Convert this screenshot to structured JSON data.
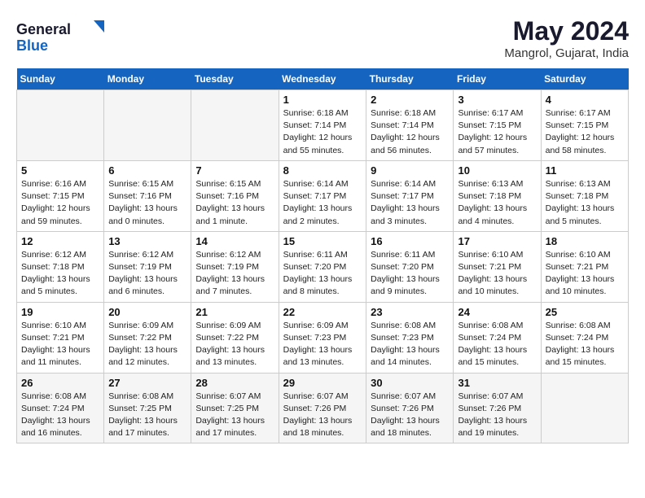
{
  "logo": {
    "general": "General",
    "blue": "Blue"
  },
  "title": {
    "month": "May 2024",
    "location": "Mangrol, Gujarat, India"
  },
  "weekdays": [
    "Sunday",
    "Monday",
    "Tuesday",
    "Wednesday",
    "Thursday",
    "Friday",
    "Saturday"
  ],
  "weeks": [
    [
      {
        "day": "",
        "sunrise": "",
        "sunset": "",
        "daylight": ""
      },
      {
        "day": "",
        "sunrise": "",
        "sunset": "",
        "daylight": ""
      },
      {
        "day": "",
        "sunrise": "",
        "sunset": "",
        "daylight": ""
      },
      {
        "day": "1",
        "sunrise": "Sunrise: 6:18 AM",
        "sunset": "Sunset: 7:14 PM",
        "daylight": "Daylight: 12 hours and 55 minutes."
      },
      {
        "day": "2",
        "sunrise": "Sunrise: 6:18 AM",
        "sunset": "Sunset: 7:14 PM",
        "daylight": "Daylight: 12 hours and 56 minutes."
      },
      {
        "day": "3",
        "sunrise": "Sunrise: 6:17 AM",
        "sunset": "Sunset: 7:15 PM",
        "daylight": "Daylight: 12 hours and 57 minutes."
      },
      {
        "day": "4",
        "sunrise": "Sunrise: 6:17 AM",
        "sunset": "Sunset: 7:15 PM",
        "daylight": "Daylight: 12 hours and 58 minutes."
      }
    ],
    [
      {
        "day": "5",
        "sunrise": "Sunrise: 6:16 AM",
        "sunset": "Sunset: 7:15 PM",
        "daylight": "Daylight: 12 hours and 59 minutes."
      },
      {
        "day": "6",
        "sunrise": "Sunrise: 6:15 AM",
        "sunset": "Sunset: 7:16 PM",
        "daylight": "Daylight: 13 hours and 0 minutes."
      },
      {
        "day": "7",
        "sunrise": "Sunrise: 6:15 AM",
        "sunset": "Sunset: 7:16 PM",
        "daylight": "Daylight: 13 hours and 1 minute."
      },
      {
        "day": "8",
        "sunrise": "Sunrise: 6:14 AM",
        "sunset": "Sunset: 7:17 PM",
        "daylight": "Daylight: 13 hours and 2 minutes."
      },
      {
        "day": "9",
        "sunrise": "Sunrise: 6:14 AM",
        "sunset": "Sunset: 7:17 PM",
        "daylight": "Daylight: 13 hours and 3 minutes."
      },
      {
        "day": "10",
        "sunrise": "Sunrise: 6:13 AM",
        "sunset": "Sunset: 7:18 PM",
        "daylight": "Daylight: 13 hours and 4 minutes."
      },
      {
        "day": "11",
        "sunrise": "Sunrise: 6:13 AM",
        "sunset": "Sunset: 7:18 PM",
        "daylight": "Daylight: 13 hours and 5 minutes."
      }
    ],
    [
      {
        "day": "12",
        "sunrise": "Sunrise: 6:12 AM",
        "sunset": "Sunset: 7:18 PM",
        "daylight": "Daylight: 13 hours and 5 minutes."
      },
      {
        "day": "13",
        "sunrise": "Sunrise: 6:12 AM",
        "sunset": "Sunset: 7:19 PM",
        "daylight": "Daylight: 13 hours and 6 minutes."
      },
      {
        "day": "14",
        "sunrise": "Sunrise: 6:12 AM",
        "sunset": "Sunset: 7:19 PM",
        "daylight": "Daylight: 13 hours and 7 minutes."
      },
      {
        "day": "15",
        "sunrise": "Sunrise: 6:11 AM",
        "sunset": "Sunset: 7:20 PM",
        "daylight": "Daylight: 13 hours and 8 minutes."
      },
      {
        "day": "16",
        "sunrise": "Sunrise: 6:11 AM",
        "sunset": "Sunset: 7:20 PM",
        "daylight": "Daylight: 13 hours and 9 minutes."
      },
      {
        "day": "17",
        "sunrise": "Sunrise: 6:10 AM",
        "sunset": "Sunset: 7:21 PM",
        "daylight": "Daylight: 13 hours and 10 minutes."
      },
      {
        "day": "18",
        "sunrise": "Sunrise: 6:10 AM",
        "sunset": "Sunset: 7:21 PM",
        "daylight": "Daylight: 13 hours and 10 minutes."
      }
    ],
    [
      {
        "day": "19",
        "sunrise": "Sunrise: 6:10 AM",
        "sunset": "Sunset: 7:21 PM",
        "daylight": "Daylight: 13 hours and 11 minutes."
      },
      {
        "day": "20",
        "sunrise": "Sunrise: 6:09 AM",
        "sunset": "Sunset: 7:22 PM",
        "daylight": "Daylight: 13 hours and 12 minutes."
      },
      {
        "day": "21",
        "sunrise": "Sunrise: 6:09 AM",
        "sunset": "Sunset: 7:22 PM",
        "daylight": "Daylight: 13 hours and 13 minutes."
      },
      {
        "day": "22",
        "sunrise": "Sunrise: 6:09 AM",
        "sunset": "Sunset: 7:23 PM",
        "daylight": "Daylight: 13 hours and 13 minutes."
      },
      {
        "day": "23",
        "sunrise": "Sunrise: 6:08 AM",
        "sunset": "Sunset: 7:23 PM",
        "daylight": "Daylight: 13 hours and 14 minutes."
      },
      {
        "day": "24",
        "sunrise": "Sunrise: 6:08 AM",
        "sunset": "Sunset: 7:24 PM",
        "daylight": "Daylight: 13 hours and 15 minutes."
      },
      {
        "day": "25",
        "sunrise": "Sunrise: 6:08 AM",
        "sunset": "Sunset: 7:24 PM",
        "daylight": "Daylight: 13 hours and 15 minutes."
      }
    ],
    [
      {
        "day": "26",
        "sunrise": "Sunrise: 6:08 AM",
        "sunset": "Sunset: 7:24 PM",
        "daylight": "Daylight: 13 hours and 16 minutes."
      },
      {
        "day": "27",
        "sunrise": "Sunrise: 6:08 AM",
        "sunset": "Sunset: 7:25 PM",
        "daylight": "Daylight: 13 hours and 17 minutes."
      },
      {
        "day": "28",
        "sunrise": "Sunrise: 6:07 AM",
        "sunset": "Sunset: 7:25 PM",
        "daylight": "Daylight: 13 hours and 17 minutes."
      },
      {
        "day": "29",
        "sunrise": "Sunrise: 6:07 AM",
        "sunset": "Sunset: 7:26 PM",
        "daylight": "Daylight: 13 hours and 18 minutes."
      },
      {
        "day": "30",
        "sunrise": "Sunrise: 6:07 AM",
        "sunset": "Sunset: 7:26 PM",
        "daylight": "Daylight: 13 hours and 18 minutes."
      },
      {
        "day": "31",
        "sunrise": "Sunrise: 6:07 AM",
        "sunset": "Sunset: 7:26 PM",
        "daylight": "Daylight: 13 hours and 19 minutes."
      },
      {
        "day": "",
        "sunrise": "",
        "sunset": "",
        "daylight": ""
      }
    ]
  ]
}
